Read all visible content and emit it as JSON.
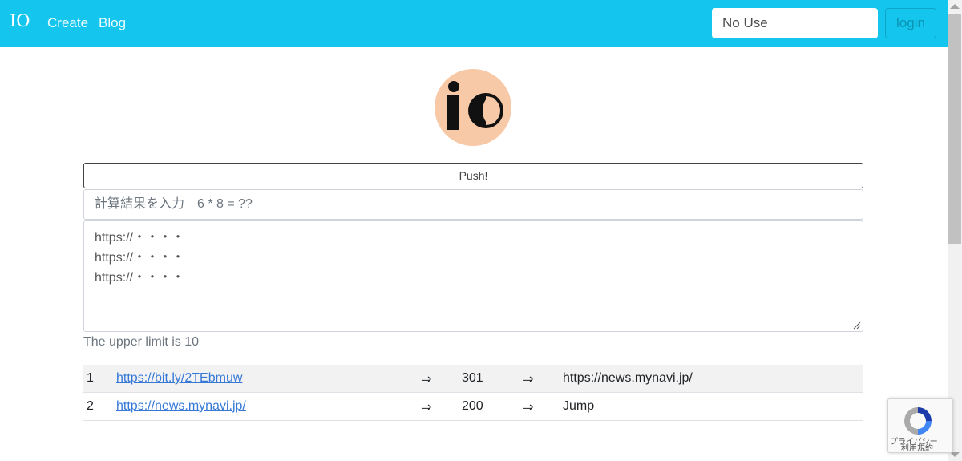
{
  "navbar": {
    "brand": "IO",
    "links": [
      "Create",
      "Blog"
    ],
    "input_placeholder": "No Use",
    "login_label": "login",
    "colors": {
      "background": "#14c6ee"
    }
  },
  "logo": {
    "text": "io",
    "circle_color": "#f8c9a6"
  },
  "form": {
    "push_label": "Push!",
    "captcha_placeholder": "計算結果を入力　6 * 8 = ??",
    "urls_placeholder": "https://・・・・\nhttps://・・・・\nhttps://・・・・",
    "limit_text": "The upper limit is 10"
  },
  "results": [
    {
      "num": "1",
      "link": "https://bit.ly/2TEbmuw",
      "arrow1": "⇒",
      "status": "301",
      "arrow2": "⇒",
      "destination": "https://news.mynavi.jp/"
    },
    {
      "num": "2",
      "link": "https://news.mynavi.jp/",
      "arrow1": "⇒",
      "status": "200",
      "arrow2": "⇒",
      "destination": "Jump"
    }
  ],
  "recaptcha": {
    "privacy": "プライバシー",
    "terms": "利用規約"
  }
}
